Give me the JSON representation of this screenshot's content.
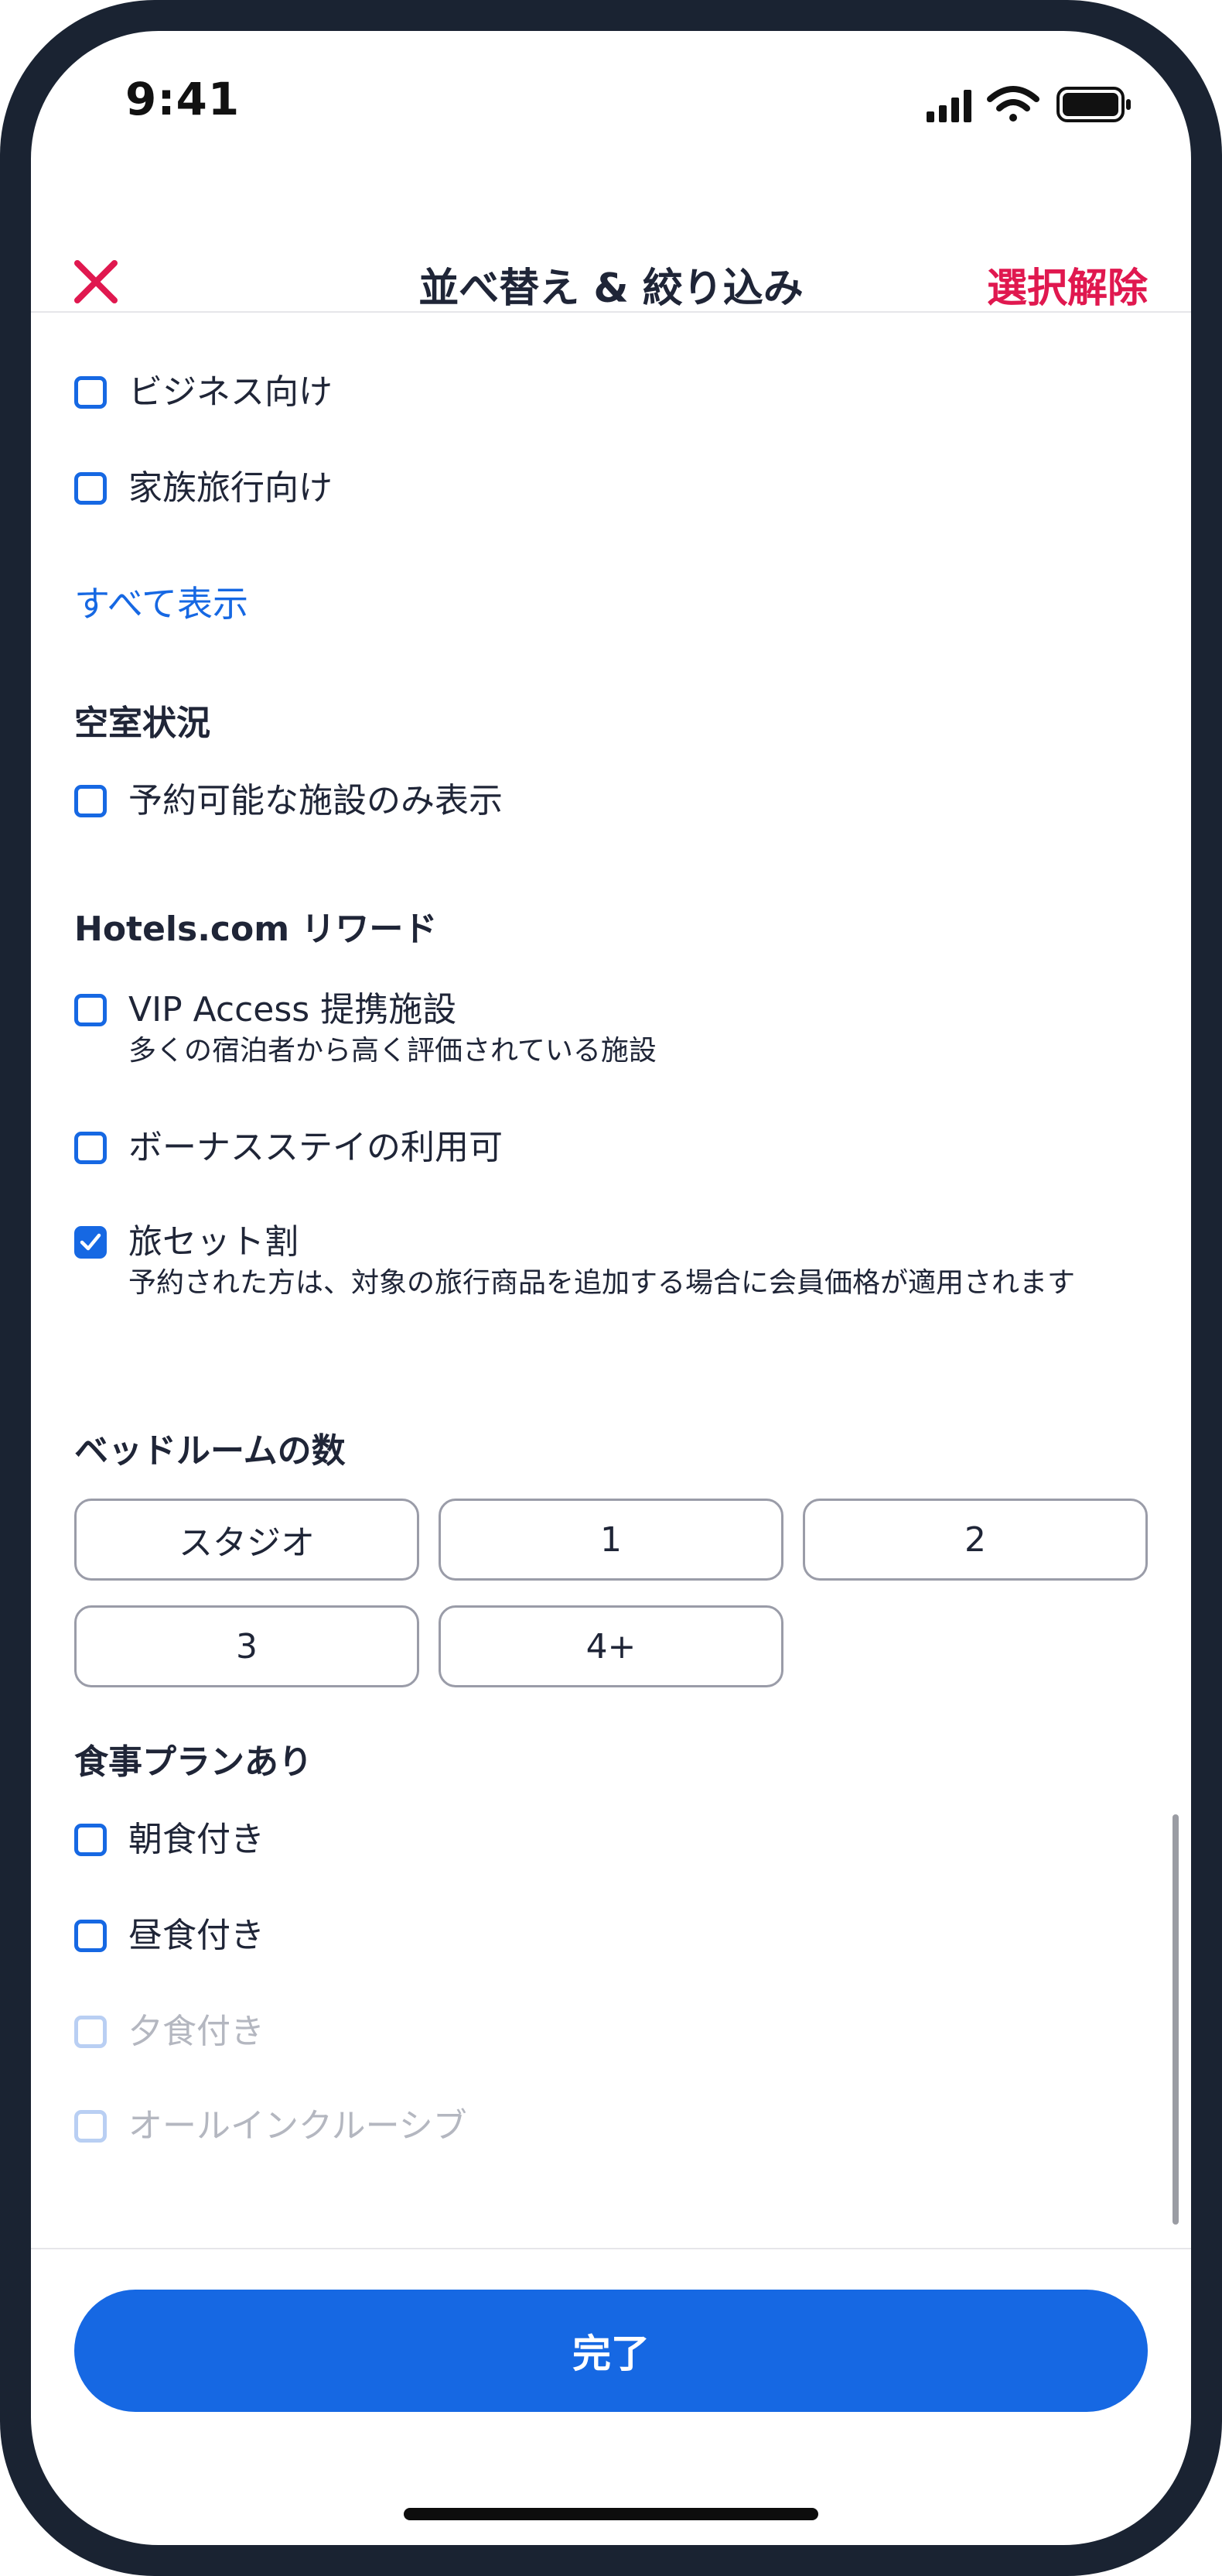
{
  "status_bar": {
    "time": "9:41",
    "icons": [
      "signal-icon",
      "wifi-icon",
      "battery-icon"
    ]
  },
  "header": {
    "title": "並べ替え & 絞り込み",
    "clear_label": "選択解除",
    "close_icon": "close-icon"
  },
  "guest_type": {
    "options": [
      {
        "label": "ビジネス向け",
        "checked": false
      },
      {
        "label": "家族旅行向け",
        "checked": false
      }
    ],
    "show_all": "すべて表示"
  },
  "availability": {
    "title": "空室状況",
    "option": {
      "label": "予約可能な施設のみ表示",
      "checked": false
    }
  },
  "rewards": {
    "title": "Hotels.com リワード",
    "options": [
      {
        "label": "VIP Access 提携施設",
        "sub": "多くの宿泊者から高く評価されている施設",
        "checked": false
      },
      {
        "label": "ボーナスステイの利用可",
        "sub": "",
        "checked": false
      },
      {
        "label": "旅セット割",
        "sub": "予約された方は、対象の旅行商品を追加する場合に会員価格が適用されます",
        "checked": true
      }
    ]
  },
  "bedrooms": {
    "title": "ベッドルームの数",
    "chips": [
      "スタジオ",
      "1",
      "2",
      "3",
      "4+"
    ]
  },
  "meal_plans": {
    "title": "食事プランあり",
    "options": [
      {
        "label": "朝食付き",
        "checked": false,
        "disabled": false
      },
      {
        "label": "昼食付き",
        "checked": false,
        "disabled": false
      },
      {
        "label": "夕食付き",
        "checked": false,
        "disabled": true
      },
      {
        "label": "オールインクルーシブ",
        "checked": false,
        "disabled": true
      }
    ]
  },
  "footer": {
    "done_label": "完了"
  },
  "colors": {
    "accent": "#1668e3",
    "clear": "#e0184f",
    "text": "#1f2537",
    "disabled_text": "#b4b7c0",
    "frame": "#1a2332"
  }
}
